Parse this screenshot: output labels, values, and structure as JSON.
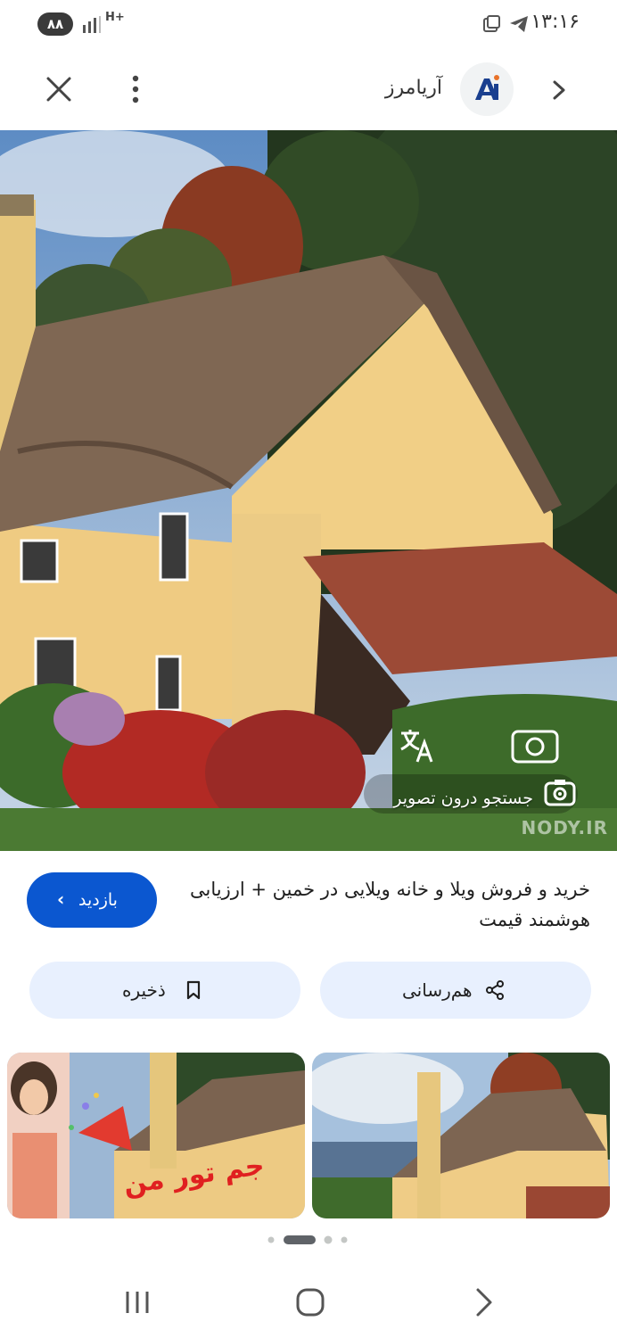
{
  "status_bar": {
    "battery": "۸۸",
    "network": "H+",
    "time": "۱۳:۱۶"
  },
  "header": {
    "site_name": "آریامرز",
    "icons": [
      "close-icon",
      "more-vert-icon",
      "site-logo",
      "chevron-right-icon"
    ]
  },
  "hero": {
    "lens_label": "جستجو درون تصویر",
    "watermark": "NODY.IR"
  },
  "result": {
    "title": "خرید و فروش ویلا و خانه ویلایی در خمین + ارزیابی هوشمند قیمت",
    "visit_label": "بازدید"
  },
  "actions": {
    "share_label": "هم‌رسانی",
    "save_label": "ذخیره"
  },
  "thumbnail_overlay_text": "جم تور من",
  "colors": {
    "accent": "#0b57d0",
    "action_bg": "#e8f0fe"
  }
}
